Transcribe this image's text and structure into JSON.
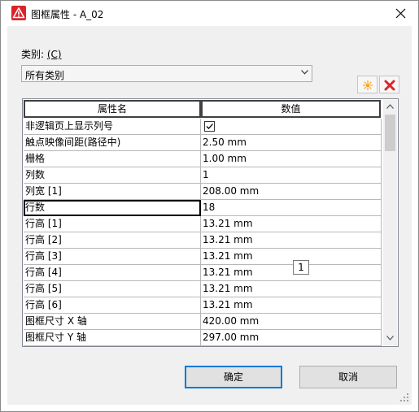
{
  "window": {
    "title": "图框属性 - A_02",
    "icon": "autodesk-warning-icon",
    "accent_color": "#d9252a"
  },
  "category": {
    "label": "类别: ",
    "hotkey": "(C)",
    "selected": "所有类别"
  },
  "toolbar": {
    "new_icon": "star-icon",
    "delete_icon": "delete-x-icon"
  },
  "grid": {
    "headers": [
      "属性名",
      "数值"
    ],
    "rows": [
      {
        "name": "非逻辑页上显示列号",
        "value": "",
        "checked": true
      },
      {
        "name": "触点映像间距(路径中)",
        "value": "2.50 mm"
      },
      {
        "name": "栅格",
        "value": "1.00 mm"
      },
      {
        "name": "列数",
        "value": "1"
      },
      {
        "name": "列宽 [1]",
        "value": "208.00 mm"
      },
      {
        "name": "行数",
        "value": "18",
        "selected": true
      },
      {
        "name": "行高 [1]",
        "value": "13.21 mm"
      },
      {
        "name": "行高 [2]",
        "value": "13.21 mm"
      },
      {
        "name": "行高 [3]",
        "value": "13.21 mm"
      },
      {
        "name": "行高 [4]",
        "value": "13.21 mm"
      },
      {
        "name": "行高 [5]",
        "value": "13.21 mm"
      },
      {
        "name": "行高 [6]",
        "value": "13.21 mm"
      },
      {
        "name": "图框尺寸 X 轴",
        "value": "420.00 mm"
      },
      {
        "name": "图框尺寸 Y 轴",
        "value": "297.00 mm"
      }
    ],
    "tooltip": "1"
  },
  "buttons": {
    "ok": "确定",
    "cancel": "取消"
  }
}
